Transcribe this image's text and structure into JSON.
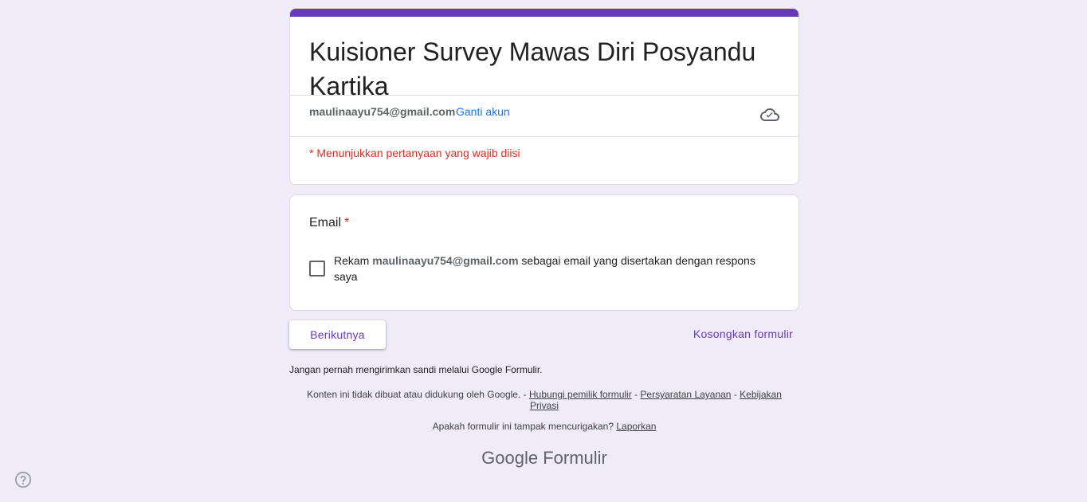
{
  "form": {
    "title": "Kuisioner Survey Mawas Diri Posyandu Kartika",
    "account_email": "maulinaayu754@gmail.com",
    "switch_account": "Ganti akun",
    "required_note": "* Menunjukkan pertanyaan yang wajib diisi",
    "accent_color": "#673ab7",
    "background_color": "#f0ebf8"
  },
  "question": {
    "label": "Email",
    "required_mark": "*",
    "checkbox_prefix": "Rekam",
    "checkbox_email": "maulinaayu754@gmail.com",
    "checkbox_suffix": "sebagai email yang disertakan dengan respons saya",
    "checked": false
  },
  "actions": {
    "next_label": "Berikutnya",
    "clear_label": "Kosongkan formulir"
  },
  "footer": {
    "password_warning": "Jangan pernah mengirimkan sandi melalui Google Formulir.",
    "disclaimer": "Konten ini tidak dibuat atau didukung oleh Google.",
    "sep": "-",
    "contact_owner": "Hubungi pemilik formulir",
    "terms": "Persyaratan Layanan",
    "privacy": "Kebijakan Privasi",
    "suspicious": "Apakah formulir ini tampak mencurigakan?",
    "report": "Laporkan",
    "brand_google": "Google",
    "brand_product": "Formulir"
  },
  "icons": {
    "cloud": "cloud-check-icon",
    "help": "help-icon"
  }
}
